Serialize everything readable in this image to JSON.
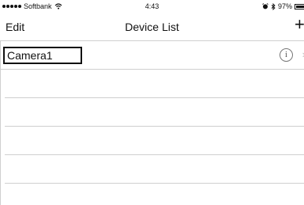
{
  "status_bar": {
    "carrier": "Softbank",
    "time": "4:43",
    "battery": "97%"
  },
  "nav": {
    "edit_label": "Edit",
    "title": "Device List",
    "add_label": "+"
  },
  "devices": [
    {
      "name": "Camera1",
      "info_icon": "info-icon",
      "chevron": "›"
    }
  ]
}
